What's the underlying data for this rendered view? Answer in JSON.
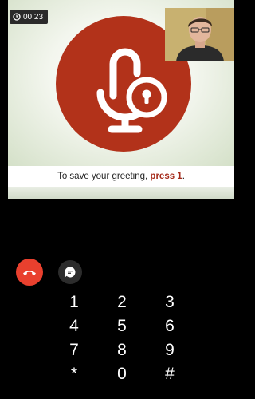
{
  "call": {
    "timer": "00:23"
  },
  "prompt": {
    "text_before": "To save your greeting, ",
    "text_emphasis": "press 1",
    "text_after": "."
  },
  "icons": {
    "timer": "clock-icon",
    "hero": "voicemail-greeting-lock-icon",
    "end_call": "phone-hangup-icon",
    "message": "chat-bubble-icon"
  },
  "colors": {
    "hero_circle": "#b2321a",
    "end_call": "#e9402e",
    "emphasis_text": "#a52a1a"
  },
  "dialpad": {
    "keys": [
      "1",
      "2",
      "3",
      "4",
      "5",
      "6",
      "7",
      "8",
      "9",
      "*",
      "0",
      "#"
    ]
  }
}
